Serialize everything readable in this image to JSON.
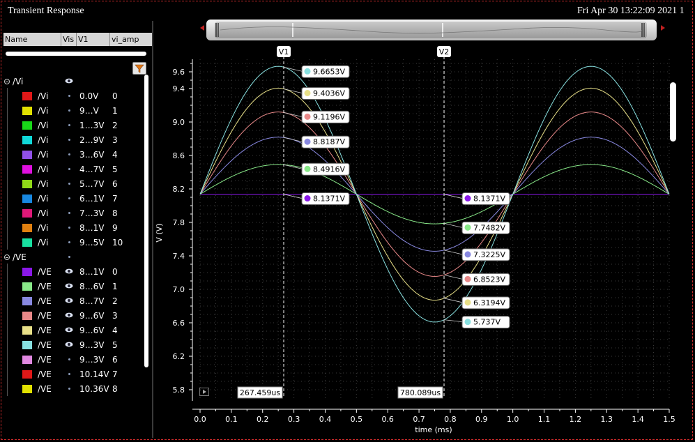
{
  "window": {
    "title": "Transient Response",
    "datetime": "Fri Apr 30 13:22:09 2021  1"
  },
  "signal_table": {
    "columns": [
      "Name",
      "Vis",
      "V1",
      "vi_amp"
    ],
    "groups": [
      {
        "name": "/Vi",
        "rows": [
          {
            "name": "/Vi",
            "v1": "0.0V",
            "idx": "0",
            "color": "#e01818",
            "eye": false
          },
          {
            "name": "/Vi",
            "v1": "9…V",
            "idx": "1",
            "color": "#e0e000",
            "eye": false
          },
          {
            "name": "/Vi",
            "v1": "1…3V",
            "idx": "2",
            "color": "#18d818",
            "eye": false
          },
          {
            "name": "/Vi",
            "v1": "2…9V",
            "idx": "3",
            "color": "#10d8d8",
            "eye": false
          },
          {
            "name": "/Vi",
            "v1": "3…6V",
            "idx": "4",
            "color": "#9050e8",
            "eye": false
          },
          {
            "name": "/Vi",
            "v1": "4…7V",
            "idx": "5",
            "color": "#e010e0",
            "eye": false
          },
          {
            "name": "/Vi",
            "v1": "5…7V",
            "idx": "6",
            "color": "#90d818",
            "eye": false
          },
          {
            "name": "/Vi",
            "v1": "6…1V",
            "idx": "7",
            "color": "#1888e0",
            "eye": false
          },
          {
            "name": "/Vi",
            "v1": "7…3V",
            "idx": "8",
            "color": "#e01878",
            "eye": false
          },
          {
            "name": "/Vi",
            "v1": "8…1V",
            "idx": "9",
            "color": "#e08010",
            "eye": false
          },
          {
            "name": "/Vi",
            "v1": "9…5V",
            "idx": "10",
            "color": "#18e0a0",
            "eye": false
          }
        ]
      },
      {
        "name": "/VE",
        "rows": [
          {
            "name": "/VE",
            "v1": "8…1V",
            "idx": "0",
            "color": "#8a18e8",
            "eye": true
          },
          {
            "name": "/VE",
            "v1": "8…6V",
            "idx": "1",
            "color": "#88e888",
            "eye": true
          },
          {
            "name": "/VE",
            "v1": "8…7V",
            "idx": "2",
            "color": "#8888e0",
            "eye": true
          },
          {
            "name": "/VE",
            "v1": "9…6V",
            "idx": "3",
            "color": "#e88888",
            "eye": true
          },
          {
            "name": "/VE",
            "v1": "9…6V",
            "idx": "4",
            "color": "#e8e088",
            "eye": true
          },
          {
            "name": "/VE",
            "v1": "9…3V",
            "idx": "5",
            "color": "#88e0e0",
            "eye": true
          },
          {
            "name": "/VE",
            "v1": "9…3V",
            "idx": "6",
            "color": "#e088e0",
            "eye": false
          },
          {
            "name": "/VE",
            "v1": "10.14V",
            "idx": "7",
            "color": "#e01818",
            "eye": false
          },
          {
            "name": "/VE",
            "v1": "10.36V",
            "idx": "8",
            "color": "#e0e000",
            "eye": false
          }
        ]
      }
    ]
  },
  "cursors": [
    {
      "label": "V1",
      "time_label": "267.459us",
      "x_ms": 0.2675
    },
    {
      "label": "V2",
      "time_label": "780.089us",
      "x_ms": 0.7801
    }
  ],
  "chart_data": {
    "type": "line",
    "xlabel": "time (ms)",
    "ylabel": "V (V)",
    "xlim": [
      0,
      1.5
    ],
    "ylim": [
      5.7,
      9.75
    ],
    "x_ticks": [
      "0.0",
      "0.1",
      "0.2",
      "0.3",
      "0.4",
      "0.5",
      "0.6",
      "0.7",
      "0.8",
      "0.9",
      "1.0",
      "1.1",
      "1.2",
      "1.3",
      "1.4",
      "1.5"
    ],
    "y_ticks": [
      "5.8",
      "6.2",
      "6.6",
      "7.0",
      "7.4",
      "7.8",
      "8.2",
      "8.6",
      "9.0",
      "9.4",
      "9.6"
    ],
    "grid": true,
    "period_ms": 1.0,
    "series": [
      {
        "color": "#8a18e8",
        "offset": 8.1371,
        "amplitude": 0.0,
        "v1_label": "8.1371V",
        "v2_label": "8.1371V"
      },
      {
        "color": "#88e888",
        "offset": 8.1371,
        "amplitude": 0.3545,
        "v1_label": "8.4916V",
        "v2_label": "7.7482V"
      },
      {
        "color": "#8888e0",
        "offset": 8.1371,
        "amplitude": 0.6816,
        "v1_label": "8.8187V",
        "v2_label": "7.3225V"
      },
      {
        "color": "#e88888",
        "offset": 8.1371,
        "amplitude": 0.9825,
        "v1_label": "9.1196V",
        "v2_label": "6.8523V"
      },
      {
        "color": "#e8e088",
        "offset": 8.1371,
        "amplitude": 1.2665,
        "v1_label": "9.4036V",
        "v2_label": "6.3194V"
      },
      {
        "color": "#88e0e0",
        "offset": 8.1371,
        "amplitude": 1.5282,
        "v1_label": "9.6653V",
        "v2_label": "5.737V"
      }
    ]
  }
}
